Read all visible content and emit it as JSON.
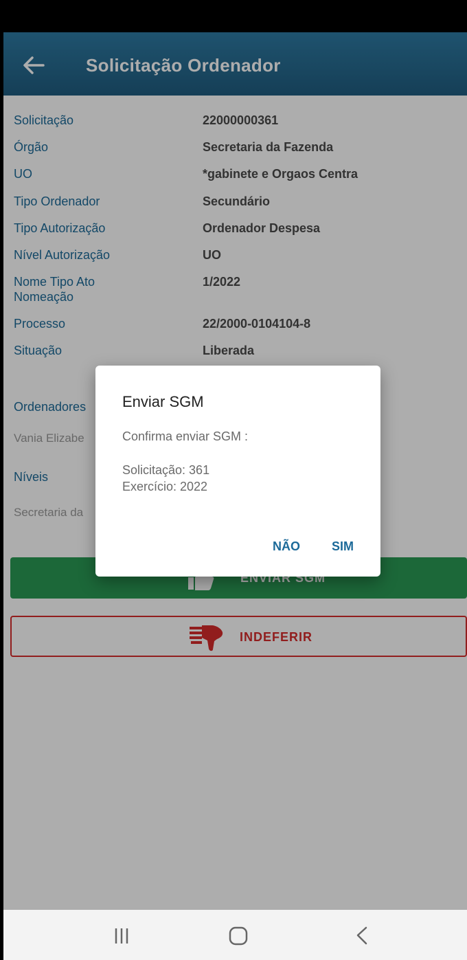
{
  "app_bar": {
    "title": "Solicitação Ordenador"
  },
  "details": [
    {
      "label": "Solicitação",
      "value": "22000000361"
    },
    {
      "label": "Órgão",
      "value": "Secretaria da Fazenda"
    },
    {
      "label": "UO",
      "value": "*gabinete e Orgaos Centra"
    },
    {
      "label": "Tipo Ordenador",
      "value": "Secundário"
    },
    {
      "label": "Tipo Autorização",
      "value": "Ordenador Despesa"
    },
    {
      "label": "Nível Autorização",
      "value": "UO"
    },
    {
      "label": "Nome Tipo Ato Nomeação",
      "value": "1/2022"
    },
    {
      "label": "Processo",
      "value": "22/2000-0104104-8"
    },
    {
      "label": "Situação",
      "value": "Liberada"
    }
  ],
  "ordenadores": {
    "title": "Ordenadores",
    "item": "Vania Elizabe"
  },
  "niveis": {
    "title": "Níveis",
    "item": "Secretaria da"
  },
  "actions": {
    "send_label": "ENVIAR SGM",
    "reject_label": "INDEFERIR"
  },
  "dialog": {
    "title": "Enviar SGM",
    "message": "Confirma enviar SGM :",
    "line1": "Solicitação: 361",
    "line2": "Exercício: 2022",
    "cancel_label": "NÃO",
    "confirm_label": "SIM"
  },
  "colors": {
    "primary": "#205d80",
    "success": "#2a9a55",
    "danger": "#d62b2b",
    "label": "#1c6a99"
  },
  "icons": {
    "back": "arrow-left-icon",
    "thumbs_up": "thumbs-up-icon",
    "thumbs_down": "thumbs-down-icon",
    "recents": "recents-icon",
    "home": "home-icon",
    "nav_back": "nav-back-icon"
  }
}
